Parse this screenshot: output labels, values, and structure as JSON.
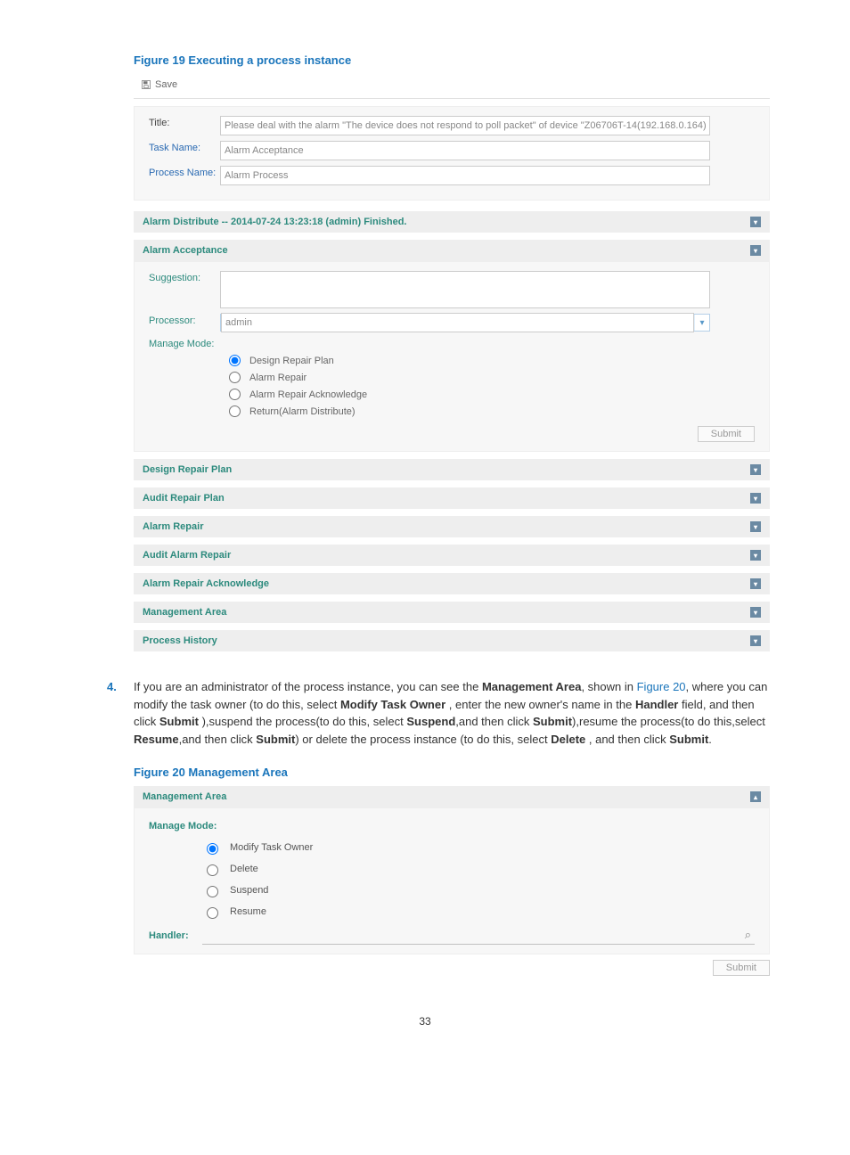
{
  "figure19": {
    "caption": "Figure 19 Executing a process instance",
    "save": "Save",
    "fields": {
      "title_label": "Title:",
      "title_value": "Please deal with the alarm \"The device does not respond to poll packet\" of device \"Z06706T-14(192.168.0.164)",
      "task_label": "Task Name:",
      "task_value": "Alarm Acceptance",
      "process_label": "Process Name:",
      "process_value": "Alarm Process"
    },
    "panels": {
      "distribute": "Alarm Distribute -- 2014-07-24 13:23:18 (admin) Finished.",
      "acceptance": {
        "title": "Alarm Acceptance",
        "suggestion_label": "Suggestion:",
        "processor_label": "Processor:",
        "processor_value": "admin",
        "manage_label": "Manage Mode:",
        "radios": [
          "Design Repair Plan",
          "Alarm Repair",
          "Alarm Repair Acknowledge",
          "Return(Alarm Distribute)"
        ],
        "submit": "Submit"
      },
      "rest": [
        "Design Repair Plan",
        "Audit Repair Plan",
        "Alarm Repair",
        "Audit Alarm Repair",
        "Alarm Repair Acknowledge",
        "Management Area",
        "Process History"
      ]
    }
  },
  "step4": {
    "num": "4.",
    "text_before_fig": "If you are an administrator of the process instance, you can see the ",
    "mgmt_area_bold": "Management Area",
    "text_2": ", shown in ",
    "fig_link": "Figure 20",
    "text_3": ", where you can modify the task owner (to do this, select ",
    "modify_bold": "Modify Task Owner",
    "text_4": " , enter the new owner's name in the ",
    "handler_bold": "Handler",
    "text_5": "  field, and then click ",
    "submit_bold1": "Submit",
    "text_6": " ),suspend the process(to do this, select ",
    "suspend_bold": "Suspend",
    "text_7": ",and then click ",
    "submit_bold2": "Submit",
    "text_8": "),resume the process(to do this,select ",
    "resume_bold": "Resume",
    "text_9": ",and then click ",
    "submit_bold3": "Submit",
    "text_10": ") or delete the process instance (to do this, select ",
    "delete_bold": "Delete",
    "text_11": " , and then click ",
    "submit_bold4": "Submit",
    "text_12": "."
  },
  "figure20": {
    "caption": "Figure 20 Management Area",
    "header": "Management Area",
    "manage_label": "Manage Mode:",
    "radios": [
      "Modify Task Owner",
      "Delete",
      "Suspend",
      "Resume"
    ],
    "handler_label": "Handler:",
    "submit": "Submit"
  },
  "page_num": "33"
}
